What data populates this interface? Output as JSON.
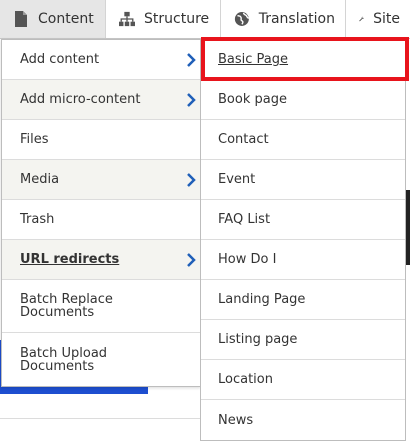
{
  "toolbar": {
    "items": [
      {
        "label": "Content",
        "icon": "file-icon"
      },
      {
        "label": "Structure",
        "icon": "sitemap-icon"
      },
      {
        "label": "Translation",
        "icon": "globe-icon"
      },
      {
        "label": "Site",
        "icon": "wrench-icon"
      }
    ]
  },
  "content_menu": {
    "items": [
      {
        "label": "Add content",
        "has_submenu": true
      },
      {
        "label": "Add micro-content",
        "has_submenu": true
      },
      {
        "label": "Files",
        "has_submenu": false
      },
      {
        "label": "Media",
        "has_submenu": true
      },
      {
        "label": "Trash",
        "has_submenu": false
      },
      {
        "label": "URL redirects",
        "has_submenu": true
      },
      {
        "label": "Batch Replace Documents",
        "has_submenu": false
      },
      {
        "label": "Batch Upload Documents",
        "has_submenu": false
      }
    ]
  },
  "add_content_submenu": {
    "items": [
      {
        "label": "Basic Page"
      },
      {
        "label": "Book page"
      },
      {
        "label": "Contact"
      },
      {
        "label": "Event"
      },
      {
        "label": "FAQ List"
      },
      {
        "label": "How Do I"
      },
      {
        "label": "Landing Page"
      },
      {
        "label": "Listing page"
      },
      {
        "label": "Location"
      },
      {
        "label": "News"
      }
    ]
  },
  "colors": {
    "highlight": "#e8141c",
    "chevron": "#1f5fb8",
    "background_accent": "#1d4ed0"
  }
}
